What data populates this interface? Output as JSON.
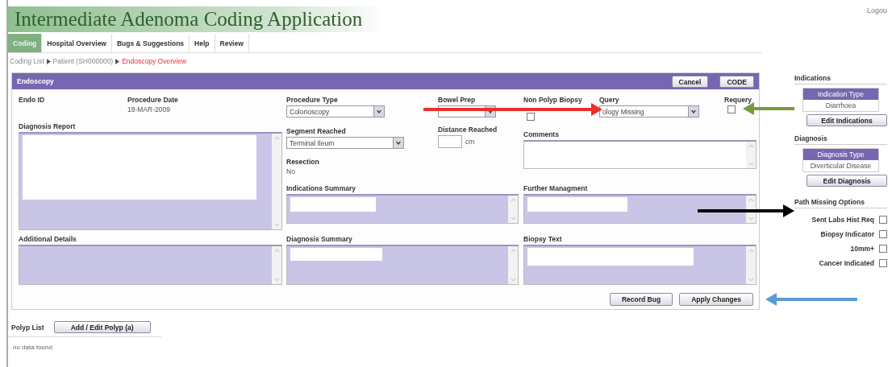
{
  "header": {
    "title": "Intermediate Adenoma Coding Application",
    "logout": "Logou"
  },
  "tabs": [
    {
      "label": "Coding",
      "selected": true
    },
    {
      "label": "Hospital Overview",
      "selected": false
    },
    {
      "label": "Bugs & Suggestions",
      "selected": false
    },
    {
      "label": "Help",
      "selected": false
    },
    {
      "label": "Review",
      "selected": false
    }
  ],
  "breadcrumb": [
    {
      "label": "Coding List",
      "current": false
    },
    {
      "label": "Patient (SH000000)",
      "current": false
    },
    {
      "label": "Endoscopy Overview",
      "current": true
    }
  ],
  "panel": {
    "title": "Endoscopy",
    "buttons": [
      "Cancel",
      "CODE"
    ],
    "endo_id": {
      "label": "Endo ID"
    },
    "procedure_date": {
      "label": "Procedure Date",
      "value": "18-MAR-2009"
    },
    "procedure_type": {
      "label": "Procedure Type",
      "value": "Colonoscopy"
    },
    "bowel_prep": {
      "label": "Bowel Prep"
    },
    "non_polyp_biopsy": {
      "label": "Non Polyp Biopsy",
      "checked": false
    },
    "query": {
      "label": "Query",
      "value": "ology Missing"
    },
    "requery": {
      "label": "Requery",
      "checked": false
    },
    "diagnosis_report": {
      "label": "Diagnosis Report",
      "readonly": true,
      "redacted": true
    },
    "segment_reached": {
      "label": "Segment Reached",
      "value": "Terminal Ileum"
    },
    "distance_reached": {
      "label": "Distance Reached",
      "unit": "cm"
    },
    "comments": {
      "label": "Comments",
      "readonly": false
    },
    "resection": {
      "label": "Resection",
      "value": "No"
    },
    "indications_summary": {
      "label": "Indications Summary",
      "readonly": true,
      "redacted": true
    },
    "further_management": {
      "label": "Further Managment",
      "readonly": true,
      "redacted": true
    },
    "additional_details": {
      "label": "Additional Details",
      "readonly": true,
      "redacted": false
    },
    "diagnosis_summary": {
      "label": "Diagnosis Summary",
      "readonly": true,
      "redacted": true
    },
    "biopsy_text": {
      "label": "Biopsy Text",
      "readonly": true,
      "redacted": true
    },
    "actions": [
      "Record Bug",
      "Apply Changes"
    ]
  },
  "polyp_list": {
    "label": "Polyp List",
    "button": "Add / Edit Polyp (a)",
    "empty_text": "no data found"
  },
  "sidebar": {
    "indications": {
      "title": "Indications",
      "column": "Indication Type",
      "rows": [
        "Diarrhoea"
      ],
      "button": "Edit Indications"
    },
    "diagnosis": {
      "title": "Diagnosis",
      "column": "Diagnosis Type",
      "rows": [
        "Diverticular Disease"
      ],
      "button": "Edit Diagnosis"
    },
    "path_missing": {
      "title": "Path Missing Options",
      "options": [
        {
          "label": "Sent Labs Hist Req",
          "checked": false
        },
        {
          "label": "Biopsy Indicator",
          "checked": false
        },
        {
          "label": "10mm+",
          "checked": false
        },
        {
          "label": "Cancer Indicated",
          "checked": false
        }
      ]
    }
  },
  "arrows": [
    {
      "color": "#e8312a",
      "kind": "right"
    },
    {
      "color": "#7a9a3a",
      "kind": "left"
    },
    {
      "color": "#000000",
      "kind": "right"
    },
    {
      "color": "#5b9bd5",
      "kind": "left"
    }
  ]
}
